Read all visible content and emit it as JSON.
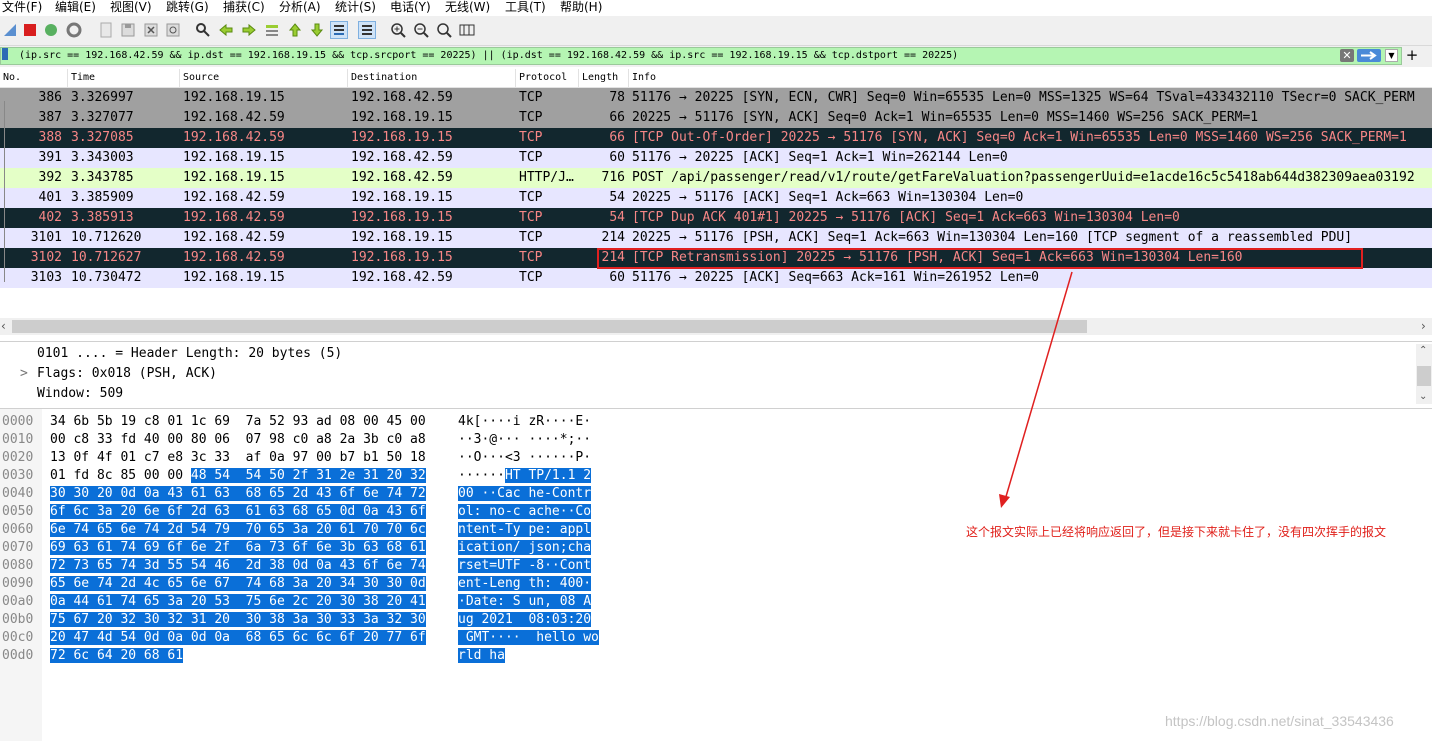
{
  "menu": [
    "文件(F)",
    "编辑(E)",
    "视图(V)",
    "跳转(G)",
    "捕获(C)",
    "分析(A)",
    "统计(S)",
    "电话(Y)",
    "无线(W)",
    "工具(T)",
    "帮助(H)"
  ],
  "toolbar_icons": [
    "shark-fin-icon",
    "stop-capture-icon",
    "restart-capture-icon",
    "capture-options-icon",
    "open-file-icon",
    "save-file-icon",
    "close-file-icon",
    "reload-file-icon",
    "find-packet-icon",
    "go-back-icon",
    "go-forward-icon",
    "go-to-packet-icon",
    "go-first-icon",
    "go-last-icon",
    "autoscroll-icon",
    "colorize-icon",
    "zoom-in-icon",
    "zoom-out-icon",
    "zoom-normal-icon",
    "resize-columns-icon"
  ],
  "filter": {
    "value": "(ip.src == 192.168.42.59 && ip.dst == 192.168.19.15 && tcp.srcport == 20225) || (ip.dst == 192.168.42.59 && ip.src == 192.168.19.15 && tcp.dstport == 20225)"
  },
  "columns": [
    "No.",
    "Time",
    "Source",
    "Destination",
    "Protocol",
    "Length",
    "Info"
  ],
  "packets": [
    {
      "no": "386",
      "time": "3.326997",
      "src": "192.168.19.15",
      "dst": "192.168.42.59",
      "proto": "TCP",
      "len": "78",
      "info": "51176 → 20225 [SYN, ECN, CWR] Seq=0 Win=65535 Len=0 MSS=1325 WS=64 TSval=433432110 TSecr=0 SACK_PERM",
      "bg": "#a0a0a0",
      "fg": "#000000"
    },
    {
      "no": "387",
      "time": "3.327077",
      "src": "192.168.42.59",
      "dst": "192.168.19.15",
      "proto": "TCP",
      "len": "66",
      "info": "20225 → 51176 [SYN, ACK] Seq=0 Ack=1 Win=65535 Len=0 MSS=1460 WS=256 SACK_PERM=1",
      "bg": "#a0a0a0",
      "fg": "#000000"
    },
    {
      "no": "388",
      "time": "3.327085",
      "src": "192.168.42.59",
      "dst": "192.168.19.15",
      "proto": "TCP",
      "len": "66",
      "info": "[TCP Out-Of-Order] 20225 → 51176 [SYN, ACK] Seq=0 Ack=1 Win=65535 Len=0 MSS=1460 WS=256 SACK_PERM=1",
      "bg": "#12272e",
      "fg": "#f78787"
    },
    {
      "no": "391",
      "time": "3.343003",
      "src": "192.168.19.15",
      "dst": "192.168.42.59",
      "proto": "TCP",
      "len": "60",
      "info": "51176 → 20225 [ACK] Seq=1 Ack=1 Win=262144 Len=0",
      "bg": "#e7e6ff",
      "fg": "#000000"
    },
    {
      "no": "392",
      "time": "3.343785",
      "src": "192.168.19.15",
      "dst": "192.168.42.59",
      "proto": "HTTP/J…",
      "len": "716",
      "info": "POST /api/passenger/read/v1/route/getFareValuation?passengerUuid=e1acde16c5c5418ab644d382309aea03192",
      "bg": "#e4ffc7",
      "fg": "#000000"
    },
    {
      "no": "401",
      "time": "3.385909",
      "src": "192.168.42.59",
      "dst": "192.168.19.15",
      "proto": "TCP",
      "len": "54",
      "info": "20225 → 51176 [ACK] Seq=1 Ack=663 Win=130304 Len=0",
      "bg": "#e7e6ff",
      "fg": "#000000"
    },
    {
      "no": "402",
      "time": "3.385913",
      "src": "192.168.42.59",
      "dst": "192.168.19.15",
      "proto": "TCP",
      "len": "54",
      "info": "[TCP Dup ACK 401#1] 20225 → 51176 [ACK] Seq=1 Ack=663 Win=130304 Len=0",
      "bg": "#12272e",
      "fg": "#f78787"
    },
    {
      "no": "3101",
      "time": "10.712620",
      "src": "192.168.42.59",
      "dst": "192.168.19.15",
      "proto": "TCP",
      "len": "214",
      "info": "20225 → 51176 [PSH, ACK] Seq=1 Ack=663 Win=130304 Len=160 [TCP segment of a reassembled PDU]",
      "bg": "#e7e6ff",
      "fg": "#000000"
    },
    {
      "no": "3102",
      "time": "10.712627",
      "src": "192.168.42.59",
      "dst": "192.168.19.15",
      "proto": "TCP",
      "len": "214",
      "info": "[TCP Retransmission] 20225 → 51176 [PSH, ACK] Seq=1 Ack=663 Win=130304 Len=160",
      "bg": "#12272e",
      "fg": "#f78787"
    },
    {
      "no": "3103",
      "time": "10.730472",
      "src": "192.168.19.15",
      "dst": "192.168.42.59",
      "proto": "TCP",
      "len": "60",
      "info": "51176 → 20225 [ACK] Seq=663 Ack=161 Win=261952 Len=0",
      "bg": "#e7e6ff",
      "fg": "#000000"
    }
  ],
  "details": [
    {
      "prefix": "",
      "text": "0101 .... = Header Length: 20 bytes (5)"
    },
    {
      "prefix": ">",
      "text": "Flags: 0x018 (PSH, ACK)"
    },
    {
      "prefix": "",
      "text": "Window: 509"
    }
  ],
  "bytes": [
    {
      "off": "0000",
      "hex": [
        [
          "34 6b 5b 19 c8 01 1c 69  7a 52 93 ad 08 00 45 00",
          ""
        ]
      ],
      "ascii": [
        [
          "4k[····i zR····E·",
          ""
        ]
      ]
    },
    {
      "off": "0010",
      "hex": [
        [
          "00 c8 33 fd 40 00 80 06  07 98 c0 a8 2a 3b c0 a8",
          ""
        ]
      ],
      "ascii": [
        [
          "··3·@··· ····*;··",
          ""
        ]
      ]
    },
    {
      "off": "0020",
      "hex": [
        [
          "13 0f 4f 01 c7 e8 3c 33  af 0a 97 00 b7 b1 50 18",
          ""
        ]
      ],
      "ascii": [
        [
          "··O···<3 ······P·",
          ""
        ]
      ]
    },
    {
      "off": "0030",
      "hex": [
        [
          "01 fd 8c 85 00 00 ",
          ""
        ],
        [
          "48 54  54 50 2f 31 2e 31 20 32",
          "hl"
        ]
      ],
      "ascii": [
        [
          "······",
          ""
        ],
        [
          "HT TP/1.1 2",
          "hl"
        ]
      ]
    },
    {
      "off": "0040",
      "hex": [
        [
          "30 30 20 0d 0a 43 61 63  68 65 2d 43 6f 6e 74 72",
          "hl"
        ]
      ],
      "ascii": [
        [
          "00 ··Cac he-Contr",
          "hl"
        ]
      ]
    },
    {
      "off": "0050",
      "hex": [
        [
          "6f 6c 3a 20 6e 6f 2d 63  61 63 68 65 0d 0a 43 6f",
          "hl"
        ]
      ],
      "ascii": [
        [
          "ol: no-c ache··Co",
          "hl"
        ]
      ]
    },
    {
      "off": "0060",
      "hex": [
        [
          "6e 74 65 6e 74 2d 54 79  70 65 3a 20 61 70 70 6c",
          "hl"
        ]
      ],
      "ascii": [
        [
          "ntent-Ty pe: appl",
          "hl"
        ]
      ]
    },
    {
      "off": "0070",
      "hex": [
        [
          "69 63 61 74 69 6f 6e 2f  6a 73 6f 6e 3b 63 68 61",
          "hl"
        ]
      ],
      "ascii": [
        [
          "ication/ json;cha",
          "hl"
        ]
      ]
    },
    {
      "off": "0080",
      "hex": [
        [
          "72 73 65 74 3d 55 54 46  2d 38 0d 0a 43 6f 6e 74",
          "hl"
        ]
      ],
      "ascii": [
        [
          "rset=UTF -8··Cont",
          "hl"
        ]
      ]
    },
    {
      "off": "0090",
      "hex": [
        [
          "65 6e 74 2d 4c 65 6e 67  74 68 3a 20 34 30 30 0d",
          "hl"
        ]
      ],
      "ascii": [
        [
          "ent-Leng th: 400·",
          "hl"
        ]
      ]
    },
    {
      "off": "00a0",
      "hex": [
        [
          "0a 44 61 74 65 3a 20 53  75 6e 2c 20 30 38 20 41",
          "hl"
        ]
      ],
      "ascii": [
        [
          "·Date: S un, 08 A",
          "hl"
        ]
      ]
    },
    {
      "off": "00b0",
      "hex": [
        [
          "75 67 20 32 30 32 31 20  30 38 3a 30 33 3a 32 30",
          "hl"
        ]
      ],
      "ascii": [
        [
          "ug 2021  08:03:20",
          "hl"
        ]
      ]
    },
    {
      "off": "00c0",
      "hex": [
        [
          "20 47 4d 54 0d 0a 0d 0a  68 65 6c 6c 6f 20 77 6f",
          "hl"
        ]
      ],
      "ascii": [
        [
          " GMT····  hello wo",
          "hl"
        ]
      ]
    },
    {
      "off": "00d0",
      "hex": [
        [
          "72 6c 64 20 68 61",
          "hl"
        ]
      ],
      "ascii": [
        [
          "rld ha",
          "hl"
        ]
      ]
    }
  ],
  "annotation": "这个报文实际上已经将响应返回了，但是接下来就卡住了，没有四次挥手的报文",
  "watermark": "https://blog.csdn.net/sinat_33543436",
  "colors": {
    "highlight_box": "#e02020",
    "annotation": "#e0201a",
    "bytes_highlight": "#0a6fd8",
    "filter_ok": "#b5f5b3"
  }
}
